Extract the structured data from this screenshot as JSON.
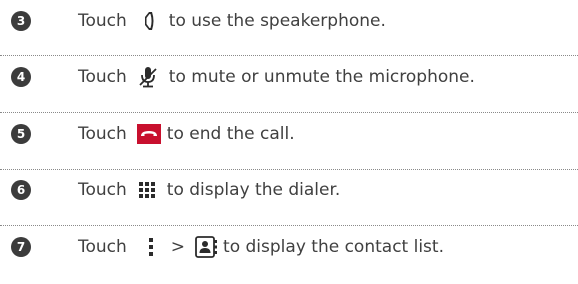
{
  "steps": [
    {
      "number": "3",
      "touch": "Touch",
      "action": "to use the speakerphone.",
      "icon": "speaker-icon"
    },
    {
      "number": "4",
      "touch": "Touch",
      "action": "to mute or unmute the microphone.",
      "icon": "microphone-mute-icon"
    },
    {
      "number": "5",
      "touch": "Touch",
      "action": "to end the call.",
      "icon": "end-call-icon"
    },
    {
      "number": "6",
      "touch": "Touch",
      "action": "to display the dialer.",
      "icon": "dialpad-icon"
    },
    {
      "number": "7",
      "touch": "Touch",
      "separator": ">",
      "action": "to display the contact list.",
      "icon": "menu-icon",
      "icon2": "contact-list-icon"
    }
  ],
  "colors": {
    "text": "#404040",
    "number_badge": "#3c3c3c",
    "end_call": "#c8102e",
    "icon": "#2b2b2b"
  }
}
